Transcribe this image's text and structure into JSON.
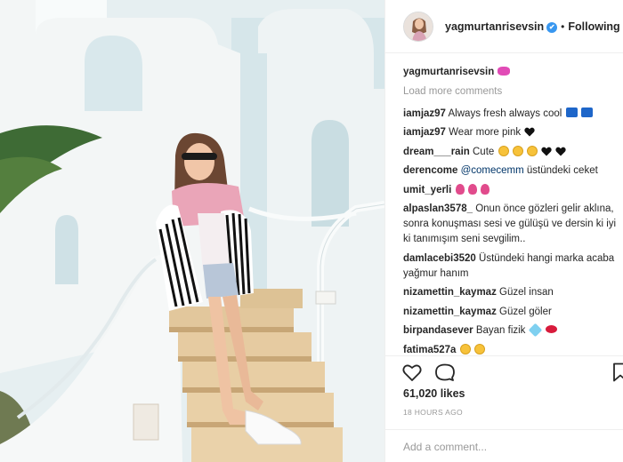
{
  "post": {
    "username": "yagmurtanrisevsin",
    "follow_state": "Following",
    "dot": "•",
    "verified_mark": "✔",
    "verified_color": "#3897f0"
  },
  "caption": {
    "username": "yagmurtanrisevsin",
    "emoji": "ribbon"
  },
  "load_more": "Load more comments",
  "comments": [
    {
      "user": "iamjaz97",
      "text": "Always fresh always cool",
      "emoji": [
        "cool-button",
        "cool-button"
      ]
    },
    {
      "user": "iamjaz97",
      "text": "Wear more pink",
      "emoji": [
        "black-heart"
      ]
    },
    {
      "user": "dream___rain",
      "text": "Cute",
      "emoji": [
        "heart-eyes-face",
        "smiling-face",
        "smiling-face",
        "black-heart",
        "black-heart"
      ]
    },
    {
      "user": "derencome",
      "mention": "@comecemm",
      "text": "üstündeki ceket"
    },
    {
      "user": "umit_yerli",
      "emoji": [
        "tulip",
        "tulip",
        "tulip"
      ]
    },
    {
      "user": "alpaslan3578_",
      "text": "Onun önce gözleri gelir aklına, sonra konuşması sesi ve gülüşü ve dersin ki iyi ki tanımışım seni sevgilim.."
    },
    {
      "user": "damlacebi3520",
      "text": "Üstündeki hangi marka acaba yağmur hanım"
    },
    {
      "user": "nizamettin_kaymaz",
      "text": "Güzel insan"
    },
    {
      "user": "nizamettin_kaymaz",
      "text": "Güzel göler"
    },
    {
      "user": "birpandasever",
      "text": "Bayan fizik",
      "emoji": [
        "gem",
        "lips"
      ]
    },
    {
      "user": "fatima527a",
      "emoji": [
        "heart-eyes-face",
        "heart-eyes-face"
      ]
    }
  ],
  "likes": "61,020 likes",
  "timestamp": "18 HOURS AGO",
  "add_comment_placeholder": "Add a comment...",
  "colors": {
    "text": "#262626",
    "muted": "#999999",
    "mention": "#003569",
    "divider": "#efefef"
  },
  "icons": {
    "like": "heart-outline-icon",
    "comment": "speech-bubble-icon",
    "save": "bookmark-icon"
  }
}
